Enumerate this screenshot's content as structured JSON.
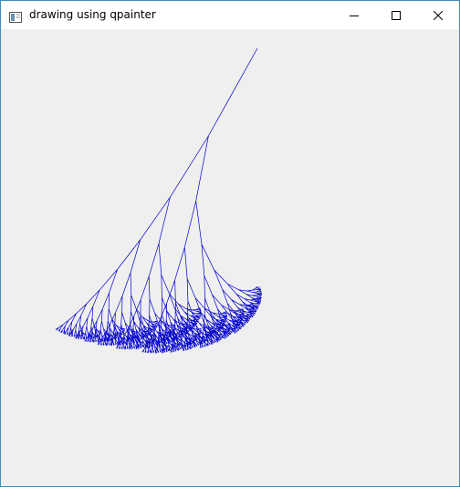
{
  "window": {
    "title": "drawing using qpainter",
    "controls": {
      "minimize_icon": "minimize-icon",
      "maximize_icon": "maximize-icon",
      "close_icon": "close-icon"
    }
  },
  "colors": {
    "client_background": "#efefef",
    "stroke": "#0000cc",
    "titlebar": "#ffffff",
    "border": "#3a8fb7"
  }
}
